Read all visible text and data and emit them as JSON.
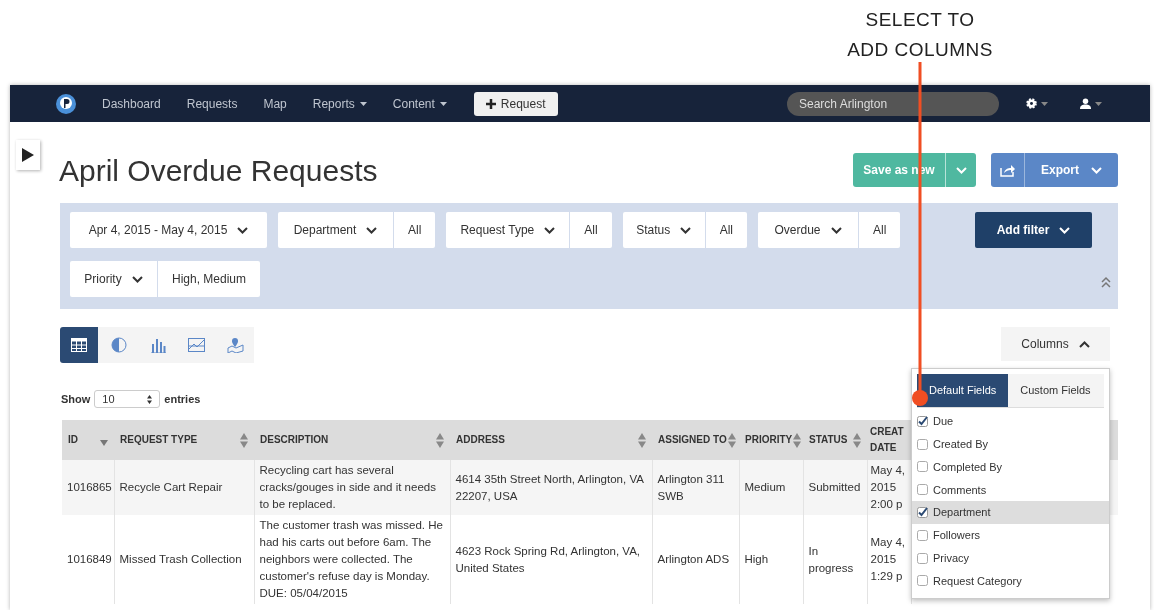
{
  "annotation": {
    "text": "SELECT TO ADD COLUMNS"
  },
  "nav": {
    "items": [
      {
        "label": "Dashboard",
        "dropdown": false
      },
      {
        "label": "Requests",
        "dropdown": false
      },
      {
        "label": "Map",
        "dropdown": false
      },
      {
        "label": "Reports",
        "dropdown": true
      },
      {
        "label": "Content",
        "dropdown": true
      }
    ],
    "new_request_button": "Request",
    "search": {
      "placeholder": "Search Arlington"
    }
  },
  "title": "April Overdue Requests",
  "save_button": "Save as new",
  "export_button": "Export",
  "filters": [
    {
      "kind": "date",
      "label": "Apr 4, 2015 - May 4, 2015"
    },
    {
      "kind": "field",
      "label": "Department",
      "value": "All"
    },
    {
      "kind": "field",
      "label": "Request Type",
      "value": "All"
    },
    {
      "kind": "field",
      "label": "Status",
      "value": "All"
    },
    {
      "kind": "field",
      "label": "Overdue",
      "value": "All"
    },
    {
      "kind": "field",
      "label": "Priority",
      "value": "High, Medium"
    }
  ],
  "add_filter_button": "Add filter",
  "view_tabs": [
    {
      "kind": "table",
      "selected": true
    },
    {
      "kind": "pie",
      "selected": false
    },
    {
      "kind": "bar",
      "selected": false
    },
    {
      "kind": "line",
      "selected": false
    },
    {
      "kind": "map",
      "selected": false
    }
  ],
  "columns_button": {
    "label": "Columns",
    "expanded": true
  },
  "page_length": {
    "label": "Show",
    "value": "10",
    "suffix": "entries"
  },
  "table": {
    "columns": [
      {
        "label": "ID",
        "sortable": true,
        "sorted": true
      },
      {
        "label": "REQUEST TYPE",
        "sortable": true,
        "sorted": false
      },
      {
        "label": "DESCRIPTION",
        "sortable": true,
        "sorted": false
      },
      {
        "label": "ADDRESS",
        "sortable": true,
        "sorted": false
      },
      {
        "label": "ASSIGNED TO",
        "sortable": true,
        "sorted": false
      },
      {
        "label": "PRIORITY",
        "sortable": true,
        "sorted": false
      },
      {
        "label": "STATUS",
        "sortable": true,
        "sorted": false
      },
      {
        "label": "CREAT DATE",
        "sortable": false
      }
    ],
    "rows": [
      [
        "1016865",
        "Recycle Cart Repair",
        "Recycling cart has several cracks/gouges in side and it needs to be replaced.",
        "4614 35th Street North, Arlington, VA 22207, USA",
        "Arlington 311 SWB",
        "Medium",
        "Submitted",
        "May 4, 2015 2:00 p"
      ],
      [
        "1016849",
        "Missed Trash Collection",
        "The customer trash was missed. He had his carts out before 6am. The neighbors were collected. The customer's refuse day is Monday. DUE: 05/04/2015",
        "4623 Rock Spring Rd, Arlington, VA, United States",
        "Arlington ADS",
        "High",
        "In progress",
        "May 4, 2015 1:29 p"
      ]
    ]
  },
  "column_menu": {
    "tabs": [
      {
        "label": "Default Fields",
        "selected": true
      },
      {
        "label": "Custom Fields",
        "selected": false
      }
    ],
    "fields": [
      {
        "label": "Due",
        "checked": true,
        "highlighted": false
      },
      {
        "label": "Created By",
        "checked": false,
        "highlighted": false
      },
      {
        "label": "Completed By",
        "checked": false,
        "highlighted": false
      },
      {
        "label": "Comments",
        "checked": false,
        "highlighted": false
      },
      {
        "label": "Department",
        "checked": true,
        "highlighted": true
      },
      {
        "label": "Followers",
        "checked": false,
        "highlighted": false
      },
      {
        "label": "Privacy",
        "checked": false,
        "highlighted": false
      },
      {
        "label": "Request Category",
        "checked": false,
        "highlighted": false
      }
    ]
  }
}
